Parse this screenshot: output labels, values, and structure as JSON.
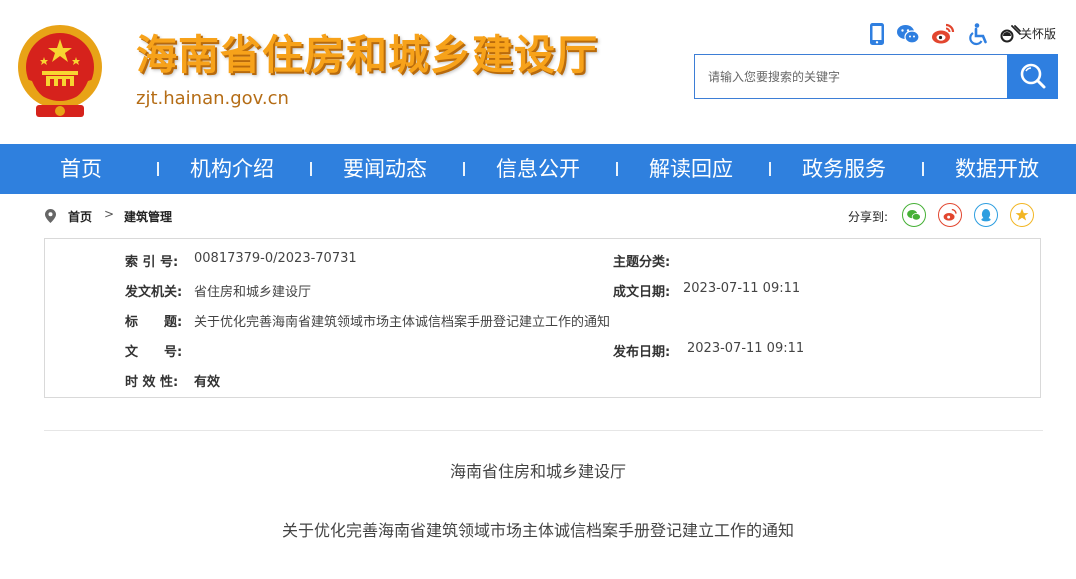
{
  "header": {
    "site_title": "海南省住房和城乡建设厅",
    "site_domain": "zjt.hainan.gov.cn",
    "care_version_label": "关怀版",
    "top_icons": [
      "mobile-icon",
      "wechat-icon",
      "weibo-icon",
      "accessibility-icon",
      "elder-care-icon"
    ],
    "search": {
      "placeholder": "请输入您要搜索的关键字",
      "value": ""
    }
  },
  "nav": {
    "items": [
      "首页",
      "机构介绍",
      "要闻动态",
      "信息公开",
      "解读回应",
      "政务服务",
      "数据开放"
    ]
  },
  "breadcrumb": {
    "home": "首页",
    "separator": ">",
    "current": "建筑管理"
  },
  "share": {
    "label": "分享到:",
    "targets": [
      {
        "icon": "wechat-share-icon",
        "color": "#45b035"
      },
      {
        "icon": "weibo-share-icon",
        "color": "#e2462f"
      },
      {
        "icon": "qq-share-icon",
        "color": "#2d9ee0"
      },
      {
        "icon": "qzone-share-icon",
        "color": "#f2b624"
      }
    ]
  },
  "info": {
    "index_label": "索 引 号:",
    "index_value": "00817379-0/2023-70731",
    "topic_label": "主题分类:",
    "topic_value": "",
    "issuer_label": "发文机关:",
    "issuer_value": "省住房和城乡建设厅",
    "written_label": "成文日期:",
    "written_value": "2023-07-11 09:11",
    "title_label": "标　　题:",
    "title_value": "关于优化完善海南省建筑领域市场主体诚信档案手册登记建立工作的通知",
    "docno_label": "文　　号:",
    "docno_value": "",
    "publish_label": "发布日期:",
    "publish_value": "2023-07-11 09:11",
    "validity_label": "时 效 性:",
    "validity_value": "有效"
  },
  "article": {
    "org": "海南省住房和城乡建设厅",
    "title": "关于优化完善海南省建筑领域市场主体诚信档案手册登记建立工作的通知"
  },
  "colors": {
    "nav_bg": "#2f80de",
    "title_orange": "#f7a21a",
    "accent_blue": "#2f7fe0"
  }
}
